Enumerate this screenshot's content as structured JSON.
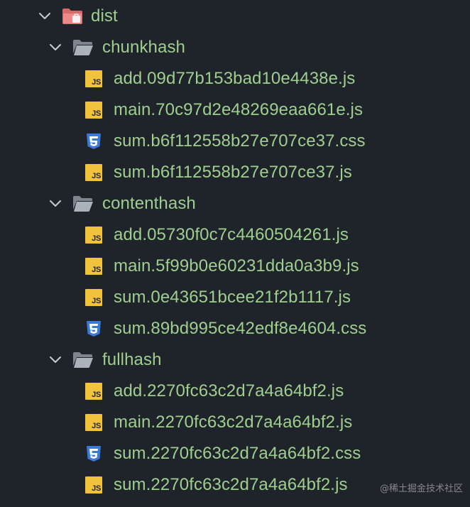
{
  "colors": {
    "background": "#1f232a",
    "text": "#9fcf8f",
    "chevron": "#c8cdd5",
    "folder_open": "#9aa3ad",
    "folder_dist": "#e07a7a",
    "js_badge": "#f0c33b",
    "css_icon": "#3b7ad8"
  },
  "tree": {
    "root": {
      "label": "dist",
      "icon": "dist-folder-icon",
      "expanded": true
    },
    "folders": [
      {
        "label": "chunkhash",
        "expanded": true,
        "files": [
          {
            "name": "add.09d77b153bad10e4438e.js",
            "type": "js"
          },
          {
            "name": "main.70c97d2e48269eaa661e.js",
            "type": "js"
          },
          {
            "name": "sum.b6f112558b27e707ce37.css",
            "type": "css"
          },
          {
            "name": "sum.b6f112558b27e707ce37.js",
            "type": "js"
          }
        ]
      },
      {
        "label": "contenthash",
        "expanded": true,
        "files": [
          {
            "name": "add.05730f0c7c4460504261.js",
            "type": "js"
          },
          {
            "name": "main.5f99b0e60231dda0a3b9.js",
            "type": "js"
          },
          {
            "name": "sum.0e43651bcee21f2b1117.js",
            "type": "js"
          },
          {
            "name": "sum.89bd995ce42edf8e4604.css",
            "type": "css"
          }
        ]
      },
      {
        "label": "fullhash",
        "expanded": true,
        "files": [
          {
            "name": "add.2270fc63c2d7a4a64bf2.js",
            "type": "js"
          },
          {
            "name": "main.2270fc63c2d7a4a64bf2.js",
            "type": "js"
          },
          {
            "name": "sum.2270fc63c2d7a4a64bf2.css",
            "type": "css"
          },
          {
            "name": "sum.2270fc63c2d7a4a64bf2.js",
            "type": "js"
          }
        ]
      }
    ]
  },
  "badges": {
    "js_text": "JS"
  },
  "watermark": {
    "text": "@稀土掘金技术社区"
  }
}
